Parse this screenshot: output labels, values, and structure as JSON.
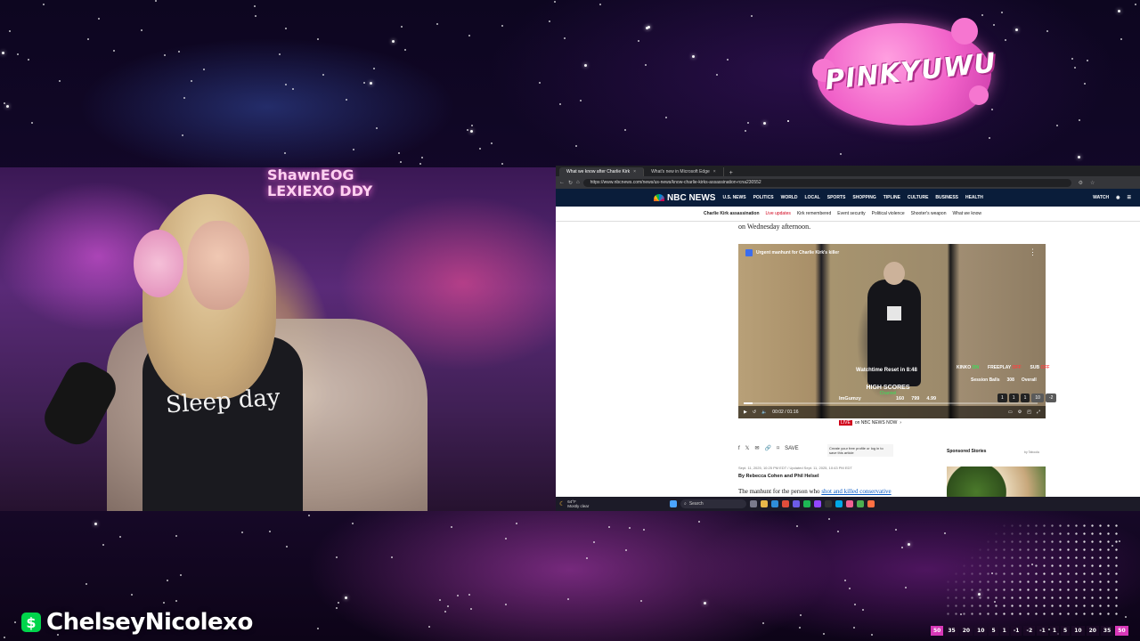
{
  "overlay": {
    "logo_text": "PINKYUWU",
    "streamer_name": "ChelseyNicolexo",
    "cashapp_icon": "dollar-sign-icon"
  },
  "webcam": {
    "shirt_text": "Sleep day",
    "neon_sign": "ShawnEOG LEXIEXO DDY"
  },
  "browser": {
    "tabs": [
      {
        "label": "What we know after Charlie Kirk"
      },
      {
        "label": "What's new in Microsoft Edge"
      }
    ],
    "new_tab": "+",
    "url": "https://www.nbcnews.com/news/us-news/know-charlie-kirks-assassination-rcna230552"
  },
  "nbc": {
    "logo": "NBC NEWS",
    "nav": [
      "U.S. NEWS",
      "POLITICS",
      "WORLD",
      "LOCAL",
      "SPORTS",
      "SHOPPING",
      "TIPLINE",
      "CULTURE",
      "BUSINESS",
      "HEALTH"
    ],
    "watch": "WATCH",
    "subnav": {
      "topic": "Charlie Kirk assassination",
      "live": "Live updates",
      "items": [
        "Kirk remembered",
        "Event security",
        "Political violence",
        "Shooter's weapon",
        "What we know"
      ]
    },
    "kicker": "on Wednesday afternoon.",
    "video": {
      "title": "Urgent manhunt for Charlie Kirk's killer",
      "time": "00:02 / 01:16",
      "progress": 0.03
    },
    "byline_date": "Sept. 11, 2025, 10:25 PM EDT / Updated Sept. 11, 2025, 10:43 PM EDT",
    "byline": "By Rebecca Cohen and Phil Helsel",
    "body_start": "The manhunt for the person who ",
    "body_link": "shot and killed conservative",
    "save_tip": "Create your free profile or log in to save this article",
    "save_label": "SAVE",
    "sponsored": "Sponsored Stories",
    "sponsored_by": "by Taboola",
    "live_badge": "LIVE",
    "live_text": "on NBC NEWS NOW"
  },
  "game_overlay": {
    "watchtime": "Watchtime Reset in 8:48",
    "high_scores_title": "HIGH SCORES",
    "channel_label": "Channel",
    "scores": [
      {
        "name": "ImGumzy",
        "a": "160",
        "b": "799",
        "c": "4.99"
      }
    ],
    "flags": [
      {
        "name": "KINKO",
        "state": "ON"
      },
      {
        "name": "FREEPLAY",
        "state": "OFF"
      },
      {
        "name": "SUB",
        "state": "OFF"
      }
    ],
    "session_balls_label": "Session Balls",
    "session_balls": "308",
    "overall_label": "Overall",
    "keys": [
      "1",
      "1",
      "1",
      "10",
      "-2"
    ]
  },
  "taskbar": {
    "weather_temp": "64°F",
    "weather_desc": "Mostly clear",
    "search": "Search"
  },
  "ticker": [
    "50",
    "35",
    "20",
    "10",
    "5",
    "1",
    "-1",
    "-2",
    "-1",
    "1",
    "5",
    "10",
    "20",
    "35",
    "50"
  ]
}
